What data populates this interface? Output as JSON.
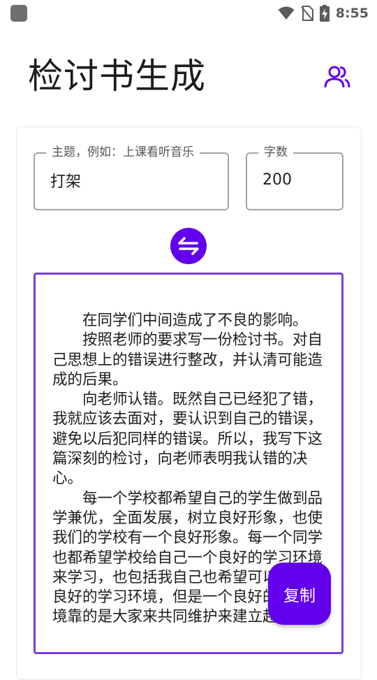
{
  "status_bar": {
    "time": "8:55",
    "icons": [
      "app-icon",
      "wifi-icon",
      "no-sim-icon",
      "battery-charging-icon"
    ]
  },
  "header": {
    "title": "检讨书生成",
    "users_icon": "users-icon"
  },
  "form": {
    "topic": {
      "label": "主题，例如：上课看听音乐",
      "value": "打架"
    },
    "word_count": {
      "label": "字数",
      "value": "200"
    },
    "swap_icon": "swap-arrows-icon"
  },
  "output": {
    "paragraphs": [
      "在同学们中间造成了不良的影响。",
      "按照老师的要求写一份检讨书。对自己思想上的错误进行整改，并认清可能造成的后果。",
      "向老师认错。既然自己已经犯了错，我就应该去面对，要认识到自己的错误，避免以后犯同样的错误。所以，我写下这篇深刻的检讨，向老师表明我认错的决心。",
      "每一个学校都希望自己的学生做到品学兼优，全面发展，树立良好形象，也使我们的学校有一个良好形象。每一个同学也都希望学校给自己一个良好的学习环境来学习，也包括我自己也希望可以有一个良好的学习环境，但是一个良好的学习环境靠的是大家来共同维护来建立起来"
    ]
  },
  "actions": {
    "copy_label": "复制"
  },
  "colors": {
    "accent": "#6200ee",
    "output_border": "#7a3de0"
  }
}
